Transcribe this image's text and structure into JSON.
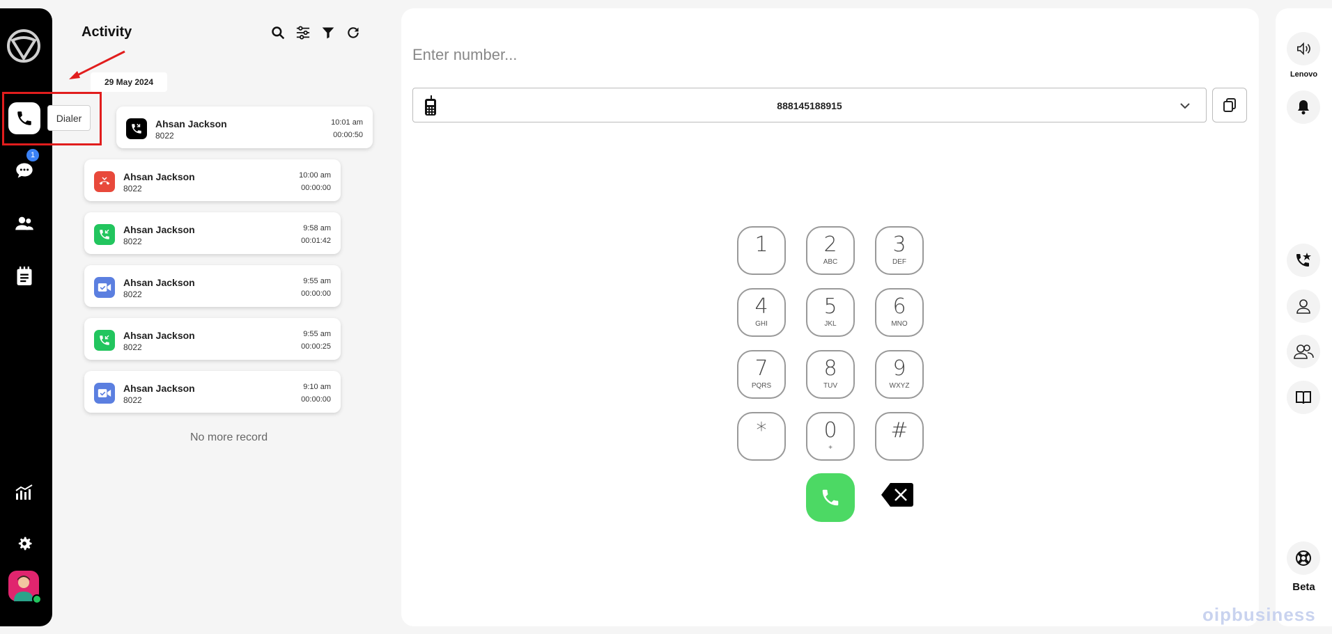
{
  "nav": {
    "tooltip": "Dialer",
    "messages_badge": "1"
  },
  "activity": {
    "title": "Activity",
    "date": "29 May 2024",
    "calls": [
      {
        "name": "Ahsan Jackson",
        "ext": "8022",
        "time": "10:01 am",
        "duration": "00:00:50",
        "type": "incoming-black",
        "color": "#000000"
      },
      {
        "name": "Ahsan Jackson",
        "ext": "8022",
        "time": "10:00 am",
        "duration": "00:00:00",
        "type": "missed",
        "color": "#e8493b"
      },
      {
        "name": "Ahsan Jackson",
        "ext": "8022",
        "time": "9:58 am",
        "duration": "00:01:42",
        "type": "incoming",
        "color": "#22c55e"
      },
      {
        "name": "Ahsan Jackson",
        "ext": "8022",
        "time": "9:55 am",
        "duration": "00:00:00",
        "type": "video",
        "color": "#5b7fe0"
      },
      {
        "name": "Ahsan Jackson",
        "ext": "8022",
        "time": "9:55 am",
        "duration": "00:00:25",
        "type": "incoming",
        "color": "#22c55e"
      },
      {
        "name": "Ahsan Jackson",
        "ext": "8022",
        "time": "9:10 am",
        "duration": "00:00:00",
        "type": "video",
        "color": "#5b7fe0"
      }
    ],
    "no_more": "No more record"
  },
  "dialer": {
    "placeholder": "Enter number...",
    "caller_id": "888145188915",
    "keys": [
      {
        "digit": "1",
        "letters": ""
      },
      {
        "digit": "2",
        "letters": "ABC"
      },
      {
        "digit": "3",
        "letters": "DEF"
      },
      {
        "digit": "4",
        "letters": "GHI"
      },
      {
        "digit": "5",
        "letters": "JKL"
      },
      {
        "digit": "6",
        "letters": "MNO"
      },
      {
        "digit": "7",
        "letters": "PQRS"
      },
      {
        "digit": "8",
        "letters": "TUV"
      },
      {
        "digit": "9",
        "letters": "WXYZ"
      },
      {
        "digit": "*",
        "letters": ""
      },
      {
        "digit": "0",
        "letters": "+"
      },
      {
        "digit": "#",
        "letters": ""
      }
    ],
    "call_color": "#4cd964"
  },
  "right": {
    "device_label": "Lenovo",
    "beta_label": "Beta"
  },
  "watermark": "oipbusiness"
}
